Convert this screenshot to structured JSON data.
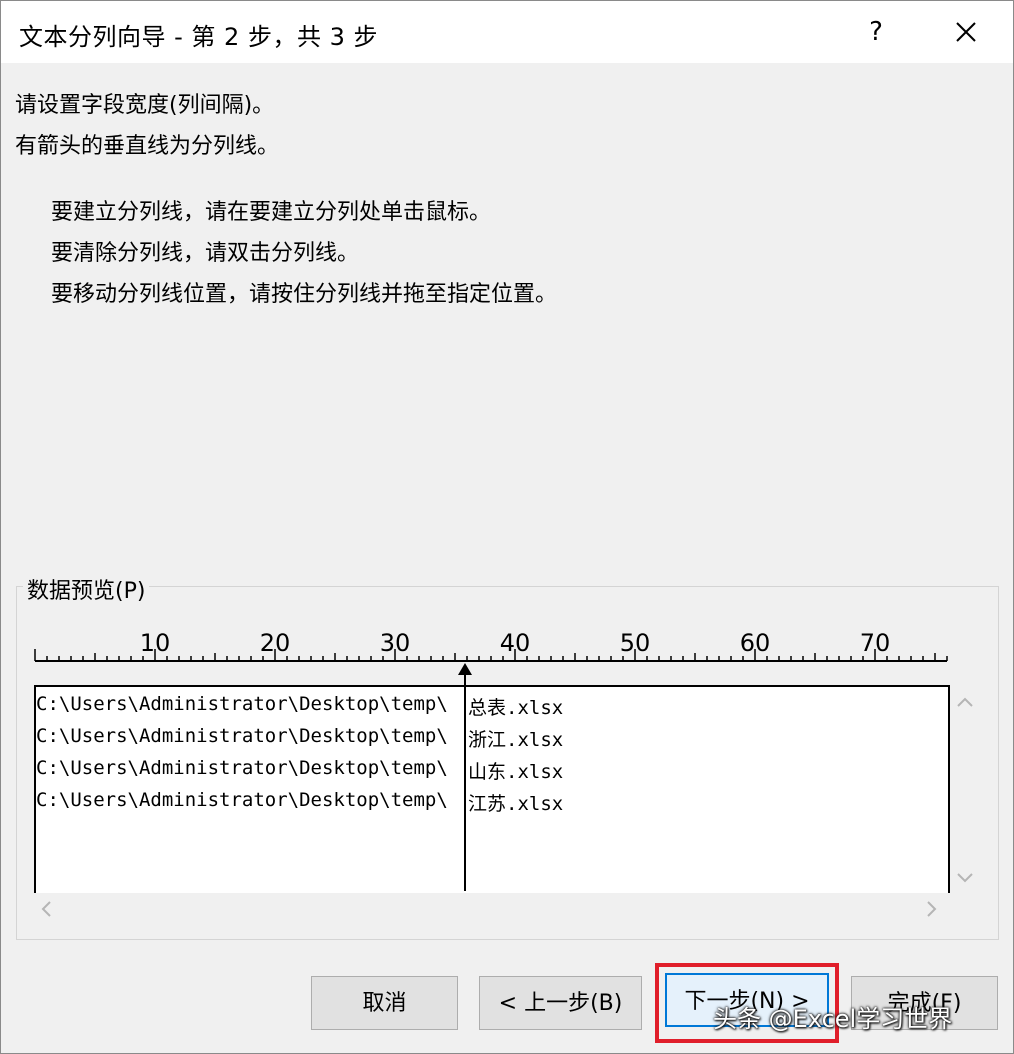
{
  "window": {
    "title": "文本分列向导 - 第 2 步，共 3 步",
    "help_label": "?",
    "close_icon": "close-icon"
  },
  "instructions": {
    "line1": "请设置字段宽度(列间隔)。",
    "line2": "有箭头的垂直线为分列线。",
    "bullet1": "要建立分列线，请在要建立分列处单击鼠标。",
    "bullet2": "要清除分列线，请双击分列线。",
    "bullet3": "要移动分列线位置，请按住分列线并拖至指定位置。"
  },
  "preview": {
    "label": "数据预览(P)",
    "ruler_numbers": [
      "10",
      "20",
      "30",
      "40",
      "50",
      "60",
      "70"
    ],
    "rows": [
      {
        "left": "C:\\Users\\Administrator\\Desktop\\temp\\",
        "right": "总表.xlsx"
      },
      {
        "left": "C:\\Users\\Administrator\\Desktop\\temp\\",
        "right": "浙江.xlsx"
      },
      {
        "left": "C:\\Users\\Administrator\\Desktop\\temp\\",
        "right": "山东.xlsx"
      },
      {
        "left": "C:\\Users\\Administrator\\Desktop\\temp\\",
        "right": "江苏.xlsx"
      }
    ],
    "break_column": 36
  },
  "buttons": {
    "cancel": "取消",
    "back": "< 上一步(B)",
    "next": "下一步(N) >",
    "finish": "完成(F)"
  },
  "watermark": "头条 @Excel学习世界",
  "colors": {
    "highlight": "#e01e2a",
    "focus": "#0078d7"
  }
}
